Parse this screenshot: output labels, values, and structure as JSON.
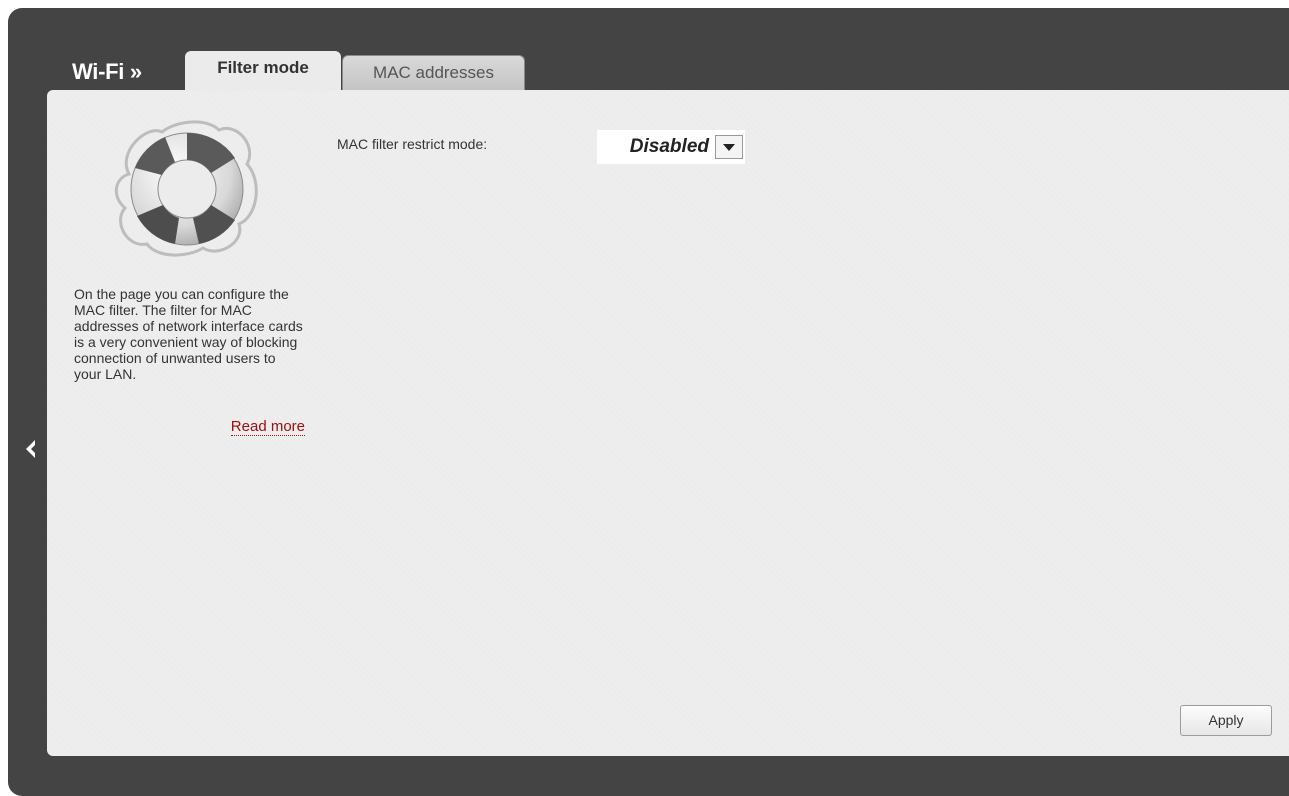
{
  "header": {
    "section_title": "Wi-Fi »",
    "tabs": [
      {
        "label": "Filter mode",
        "active": true
      },
      {
        "label": "MAC addresses",
        "active": false
      }
    ]
  },
  "sidebar": {
    "icon": "lifebuoy-icon",
    "help_text": "On the page you can configure the MAC filter. The filter for MAC addresses of network interface cards is a very convenient way of blocking connection of unwanted users to your LAN.",
    "read_more_label": "Read more"
  },
  "form": {
    "mac_filter_label": "MAC filter restrict mode:",
    "mac_filter_value": "Disabled",
    "apply_label": "Apply"
  },
  "navigation": {
    "back_icon": "chevron-left-icon"
  },
  "colors": {
    "frame": "#444444",
    "panel": "#ececec",
    "link": "#a01010"
  }
}
